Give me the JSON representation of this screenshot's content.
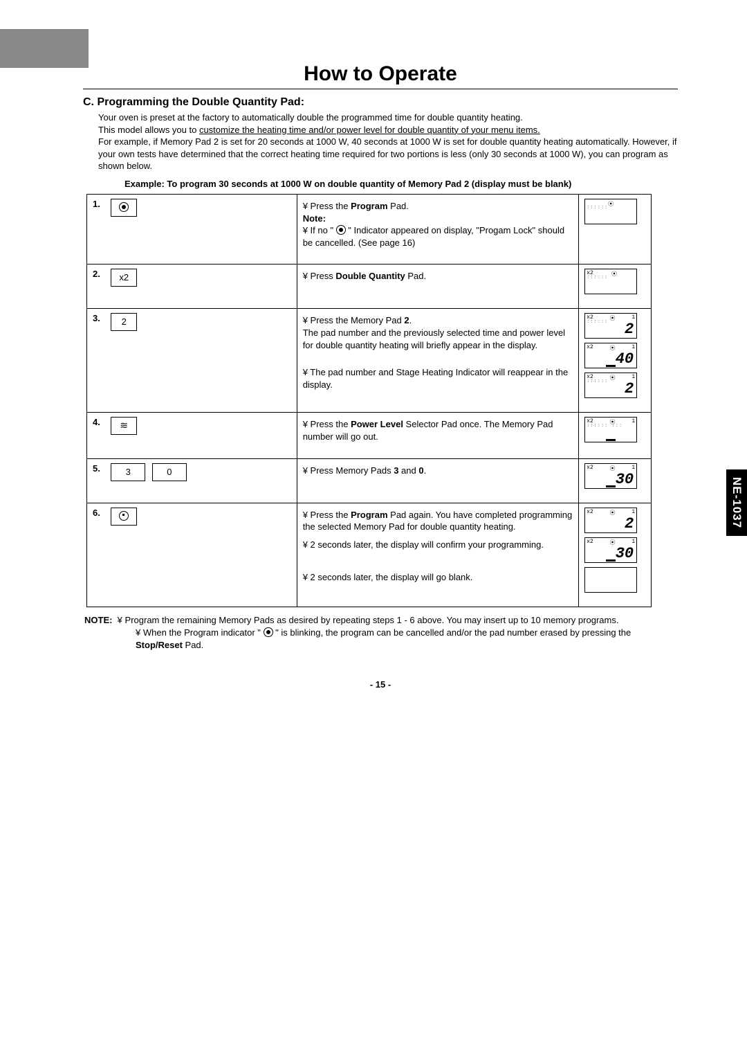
{
  "model_tab": "NE-1037",
  "page_title": "How to Operate",
  "section": "C. Programming the Double Quantity Pad:",
  "intro": {
    "p1": "Your oven is preset at the factory to automatically double the programmed time for double quantity heating.",
    "p2a": "This model allows you to ",
    "p2u": "customize the heating time and/or power level for double quantity of your menu items.",
    "p3": "For example, if Memory Pad 2 is set for 20 seconds at 1000 W, 40 seconds at 1000 W is set for double quantity heating automatically. However, if your own tests have determined that the correct heating time required for two portions is less (only 30 seconds at 1000 W), you can program as shown below."
  },
  "example": "Example: To program 30 seconds at 1000 W on double quantity of Memory Pad 2 (display must be blank)",
  "steps": [
    {
      "num": "1.",
      "key": {
        "type": "icon",
        "val": "program"
      },
      "desc": [
        {
          "pre": "yen",
          "text": "Press the ",
          "bold": "Program",
          "after": " Pad."
        },
        {
          "bold": "Note:"
        },
        {
          "pre": "yen",
          "text": "If no \" ",
          "icon": "program",
          "after": " \" Indicator appeared on display, \"Progam Lock\" should be cancelled. (See page 16)"
        }
      ],
      "displays": [
        {
          "top": [
            "",
            "⦿",
            ""
          ],
          "dots": "::::::",
          "big": "",
          "bar": false
        }
      ]
    },
    {
      "num": "2.",
      "key": {
        "type": "text",
        "val": "x2"
      },
      "desc": [
        {
          "pre": "yen",
          "text": "Press ",
          "bold": "Double Quantity",
          "after": " Pad."
        }
      ],
      "displays": [
        {
          "top": [
            "x2",
            "⦿",
            ""
          ],
          "dots": "::::::",
          "big": "",
          "bar": false
        }
      ]
    },
    {
      "num": "3.",
      "key": {
        "type": "text",
        "val": "2"
      },
      "desc": [
        {
          "pre": "yen",
          "text": "Press the Memory Pad ",
          "bold": "2",
          "after": ".\nThe pad number and the previously selected time and power level for double quantity heating will briefly appear in the display."
        },
        {
          "pre": "yen",
          "text": "The pad number and Stage Heating Indicator will reappear in the display."
        }
      ],
      "displays": [
        {
          "top": [
            "x2",
            "⦿",
            "1"
          ],
          "dots": "::::::",
          "big": "2",
          "bar": false
        },
        {
          "top": [
            "x2",
            "⦿",
            "1"
          ],
          "dots": "",
          "big": "40",
          "bar": true
        },
        {
          "top": [
            "x2",
            "⦿",
            "1"
          ],
          "dots": "::::::",
          "big": "2",
          "bar": false
        }
      ]
    },
    {
      "num": "4.",
      "key": {
        "type": "icon",
        "val": "wave"
      },
      "desc": [
        {
          "pre": "yen",
          "text": "Press the ",
          "bold": "Power Level",
          "after": " Selector Pad once. The Memory Pad number will go out."
        }
      ],
      "displays": [
        {
          "top": [
            "x2",
            "⦿",
            "1"
          ],
          "dots": "::::::  :::",
          "big": "",
          "bar": true
        }
      ]
    },
    {
      "num": "5.",
      "key": {
        "type": "multi",
        "vals": [
          "3",
          "0"
        ]
      },
      "desc": [
        {
          "pre": "yen",
          "text": "Press Memory Pads ",
          "bold": "3",
          "after": " and ",
          "bold2": "0",
          "after2": "."
        }
      ],
      "displays": [
        {
          "top": [
            "x2",
            "⦿",
            "1"
          ],
          "dots": "",
          "big": "30",
          "bar": true
        }
      ]
    },
    {
      "num": "6.",
      "key": {
        "type": "icon",
        "val": "program-sq"
      },
      "desc": [
        {
          "pre": "yen",
          "text": "Press the ",
          "bold": "Program",
          "after": " Pad again. You have completed programming the selected Memory Pad for double quantity heating."
        },
        {
          "pre": "yen",
          "text": "2 seconds later, the display will confirm your programming."
        },
        {
          "pre": "yen",
          "text": "2 seconds later, the display will go blank."
        }
      ],
      "displays": [
        {
          "top": [
            "x2",
            "⦿",
            "1"
          ],
          "dots": "",
          "big": "2",
          "bar": false
        },
        {
          "top": [
            "x2",
            "⦿",
            "1"
          ],
          "dots": "",
          "big": "30",
          "bar": true
        },
        {
          "top": [
            "",
            "",
            ""
          ],
          "dots": "",
          "big": "",
          "bar": false
        }
      ]
    }
  ],
  "notes": {
    "label": "NOTE:",
    "n1": "Program the remaining Memory Pads as desired by repeating steps 1 - 6 above. You may insert up to 10 memory programs.",
    "n2a": "When the Program indicator \" ",
    "n2b": " \" is blinking, the program can be cancelled and/or the pad number erased by pressing the ",
    "n2bold": "Stop/Reset",
    "n2c": " Pad."
  },
  "page_number": "- 15 -"
}
